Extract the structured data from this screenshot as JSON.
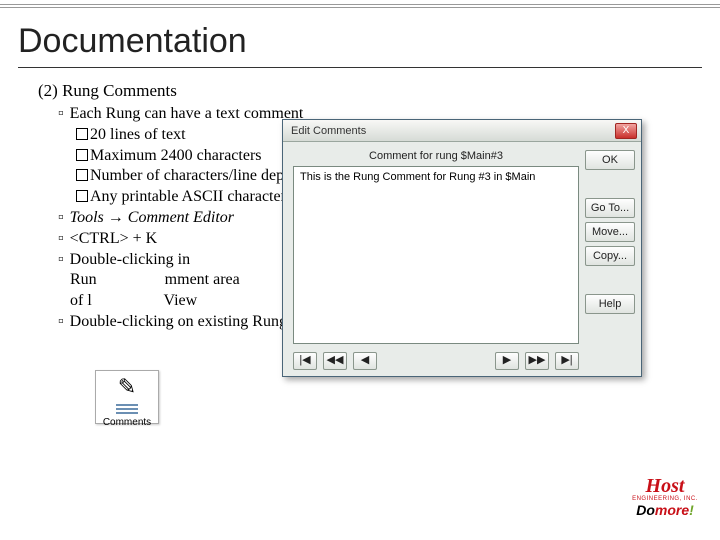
{
  "title": "Documentation",
  "section": "(2) Rung Comments",
  "bullets": {
    "b1": "Each Rung can have a text comment",
    "b2a": "20 lines of text",
    "b2b": "Maximum 2400 characters",
    "b2c": "Number of characters/line dependent on font",
    "b2d": "Any printable ASCII character",
    "b3_i": "Tools",
    "b3_arrow": " → ",
    "b3_ie": "Comment Editor",
    "b4": "<CTRL> + K",
    "b5a": "Double-clicking in",
    "b5b_prefix": "Run",
    "b5b_rest": "mment area",
    "b5c_prefix": "of l",
    "b5c_rest": " View",
    "b6": "Double-clicking on existing Rung Comment"
  },
  "icon_label": "Comments",
  "dialog": {
    "title": "Edit Comments",
    "for_label": "Comment for rung $Main#3",
    "body_text": "This is the Rung Comment for Rung #3 in $Main",
    "btns": {
      "ok": "OK",
      "goto": "Go To...",
      "move": "Move...",
      "copy": "Copy...",
      "help": "Help"
    },
    "nav": {
      "first": "|◀",
      "rew": "◀◀",
      "prev": "◀",
      "next": "▶",
      "fwd": "▶▶",
      "last": "▶|"
    },
    "close": "X"
  },
  "logo": {
    "host": "Host",
    "eng": "ENGINEERING, INC.",
    "do": "Do",
    "more": "more",
    "bang": "!"
  }
}
